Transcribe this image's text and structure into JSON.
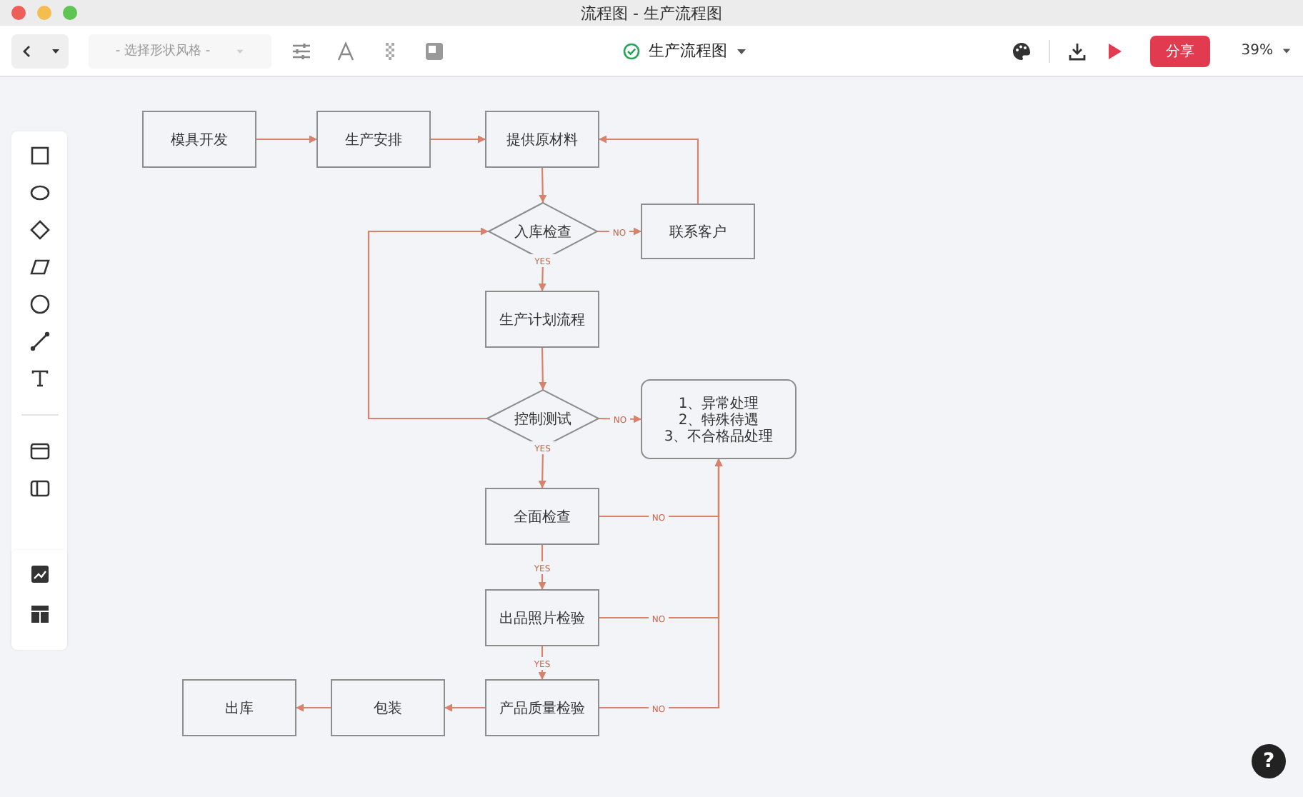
{
  "window": {
    "title": "流程图 - 生产流程图"
  },
  "toolbar": {
    "style_select": {
      "placeholder": "- 选择形状风格 -",
      "disabled": true
    },
    "document_title": "生产流程图",
    "share_button": "分享",
    "zoom": "39%"
  },
  "diagram": {
    "nodes": [
      {
        "kind": "process",
        "text": "模具开发"
      },
      {
        "kind": "process",
        "text": "生产安排"
      },
      {
        "kind": "process",
        "text": "提供原材料"
      },
      {
        "kind": "decision",
        "text": "入库检查"
      },
      {
        "kind": "process",
        "text": "联系客户"
      },
      {
        "kind": "process",
        "text": "生产计划流程"
      },
      {
        "kind": "decision",
        "text": "控制测试"
      },
      {
        "kind": "note",
        "lines": [
          "1、异常处理",
          "2、特殊待遇",
          "3、不合格品处理"
        ]
      },
      {
        "kind": "process",
        "text": "全面检查"
      },
      {
        "kind": "process",
        "text": "出品照片检验"
      },
      {
        "kind": "process",
        "text": "出库"
      },
      {
        "kind": "process",
        "text": "包装"
      },
      {
        "kind": "process",
        "text": "产品质量检验"
      }
    ],
    "edge_labels": [
      {
        "text": "NO"
      },
      {
        "text": "YES"
      },
      {
        "text": "NO"
      },
      {
        "text": "YES"
      },
      {
        "text": "YES"
      },
      {
        "text": "YES"
      },
      {
        "text": "NO"
      },
      {
        "text": "NO"
      },
      {
        "text": "NO"
      }
    ]
  },
  "help_button": "?"
}
